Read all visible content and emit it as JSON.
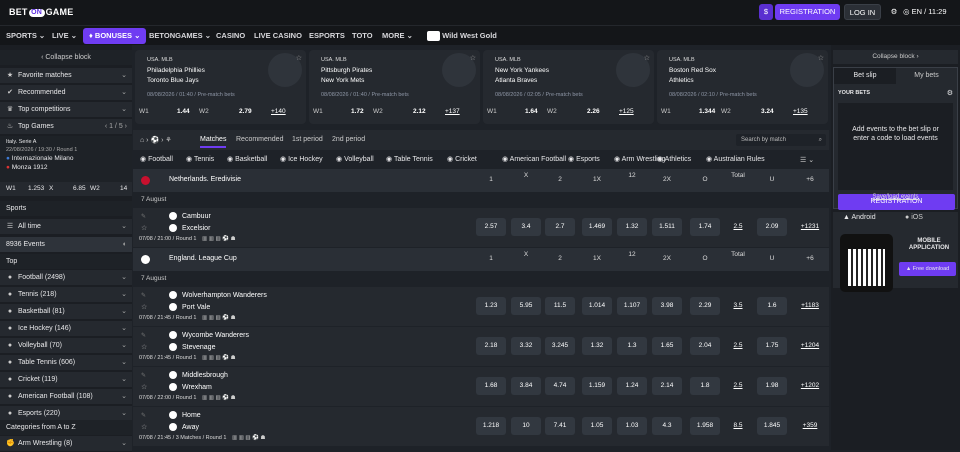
{
  "header": {
    "logo": {
      "pre": "BET",
      "mid": "ON",
      "post": "GAME"
    },
    "wallet_icon": "$",
    "registration": "REGISTRATION",
    "login": "LOG IN",
    "locale": "EN / 11:29",
    "brand_color": "#6f3cf2"
  },
  "nav": {
    "items": [
      "SPORTS",
      "LIVE",
      "BONUSES",
      "BETONGAMES",
      "CASINO",
      "LIVE CASINO",
      "ESPORTS",
      "TOTO",
      "MORE"
    ],
    "promo": "Wild West Gold"
  },
  "left": {
    "collapse": "Collapse block",
    "favorites": "Favorite matches",
    "recommended": "Recommended",
    "top_competitions": "Top competitions",
    "top_games": "Top Games",
    "pager": "1 / 5",
    "game": {
      "league": "Italy. Serie A",
      "date": "22/08/2026 / 19:30 / Round 1",
      "home": "Internazionale Milano",
      "away": "Monza 1912",
      "w1": "W1",
      "v1": "1.253",
      "x": "X",
      "vx": "6.85",
      "w2": "W2",
      "v2": "14"
    },
    "sports_title": "Sports",
    "filter": "All time",
    "events": "8936 Events",
    "top": "Top",
    "sports": [
      {
        "name": "Football",
        "count": "(2498)"
      },
      {
        "name": "Tennis",
        "count": "(218)"
      },
      {
        "name": "Basketball",
        "count": "(81)"
      },
      {
        "name": "Ice Hockey",
        "count": "(146)"
      },
      {
        "name": "Volleyball",
        "count": "(70)"
      },
      {
        "name": "Table Tennis",
        "count": "(606)"
      },
      {
        "name": "Cricket",
        "count": "(119)"
      },
      {
        "name": "American Football",
        "count": "(108)"
      },
      {
        "name": "Esports",
        "count": "(220)"
      }
    ],
    "az": "Categories from A to Z",
    "arm": {
      "name": "Arm Wrestling",
      "count": "(8)"
    }
  },
  "cards": [
    {
      "league": "USA. MLB",
      "home": "Philadelphia Phillies",
      "away": "Toronto Blue Jays",
      "date": "08/08/2026 / 01:40 / Pre-match bets",
      "w1": "W1",
      "v1": "1.44",
      "w2": "W2",
      "v2": "2.79",
      "more": "+140"
    },
    {
      "league": "USA. MLB",
      "home": "Pittsburgh Pirates",
      "away": "New York Mets",
      "date": "08/08/2026 / 01:40 / Pre-match bets",
      "w1": "W1",
      "v1": "1.72",
      "w2": "W2",
      "v2": "2.12",
      "more": "+137"
    },
    {
      "league": "USA. MLB",
      "home": "New York Yankees",
      "away": "Atlanta Braves",
      "date": "08/08/2026 / 02:05 / Pre-match bets",
      "w1": "W1",
      "v1": "1.64",
      "w2": "W2",
      "v2": "2.26",
      "more": "+125"
    },
    {
      "league": "USA. MLB",
      "home": "Boston Red Sox",
      "away": "Athletics",
      "date": "08/08/2026 / 02:10 / Pre-match bets",
      "w1": "W1",
      "v1": "1.344",
      "w2": "W2",
      "v2": "3.24",
      "more": "+135"
    }
  ],
  "tabs": {
    "items": [
      "Matches",
      "Recommended",
      "1st period",
      "2nd period"
    ],
    "search": "Search by match"
  },
  "sport_tabs": [
    "Football",
    "Tennis",
    "Basketball",
    "Ice Hockey",
    "Volleyball",
    "Table Tennis",
    "Cricket",
    "American Football",
    "Esports",
    "Arm Wrestling",
    "Athletics",
    "Australian Rules"
  ],
  "col_headers": [
    "1",
    "X",
    "2",
    "1X",
    "12",
    "2X",
    "O",
    "Total",
    "U",
    "+6"
  ],
  "sections": [
    {
      "league": "Netherlands. Eredivisie",
      "date": "7 August",
      "matches": [
        {
          "home": "Cambuur",
          "away": "Excelsior",
          "info": "07/08 / 21:00 / Round 1",
          "odds": [
            "2.57",
            "3.4",
            "2.7",
            "1.469",
            "1.32",
            "1.511",
            "1.74",
            "2.5",
            "2.09"
          ],
          "more": "+1231"
        }
      ]
    },
    {
      "league": "England. League Cup",
      "date": "7 August",
      "matches": [
        {
          "home": "Wolverhampton Wanderers",
          "away": "Port Vale",
          "info": "07/08 / 21:45 / Round 1",
          "odds": [
            "1.23",
            "5.95",
            "11.5",
            "1.014",
            "1.107",
            "3.98",
            "2.29",
            "3.5",
            "1.6"
          ],
          "more": "+1183"
        },
        {
          "home": "Wycombe Wanderers",
          "away": "Stevenage",
          "info": "07/08 / 21:45 / Round 1",
          "odds": [
            "2.18",
            "3.32",
            "3.245",
            "1.32",
            "1.3",
            "1.65",
            "2.04",
            "2.5",
            "1.75"
          ],
          "more": "+1204"
        },
        {
          "home": "Middlesbrough",
          "away": "Wrexham",
          "info": "07/08 / 22:00 / Round 1",
          "odds": [
            "1.68",
            "3.84",
            "4.74",
            "1.159",
            "1.24",
            "2.14",
            "1.8",
            "2.5",
            "1.98"
          ],
          "more": "+1202"
        },
        {
          "home": "Home",
          "away": "Away",
          "info": "07/08 / 21:45 / 3 Matches / Round 1",
          "odds": [
            "1.218",
            "10",
            "7.41",
            "1.05",
            "1.03",
            "4.3",
            "1.958",
            "8.5",
            "1.845"
          ],
          "more": "+359"
        }
      ]
    }
  ],
  "right": {
    "collapse": "Collapse block",
    "tab_slip": "Bet slip",
    "tab_my": "My bets",
    "your_bets": "YOUR BETS",
    "empty": "Add events to the bet slip or enter a code to load events",
    "registration": "REGISTRATION",
    "save": "Save/load events",
    "android": "Android",
    "ios": "iOS",
    "app": "MOBILE APPLICATION",
    "download": "Free download"
  }
}
